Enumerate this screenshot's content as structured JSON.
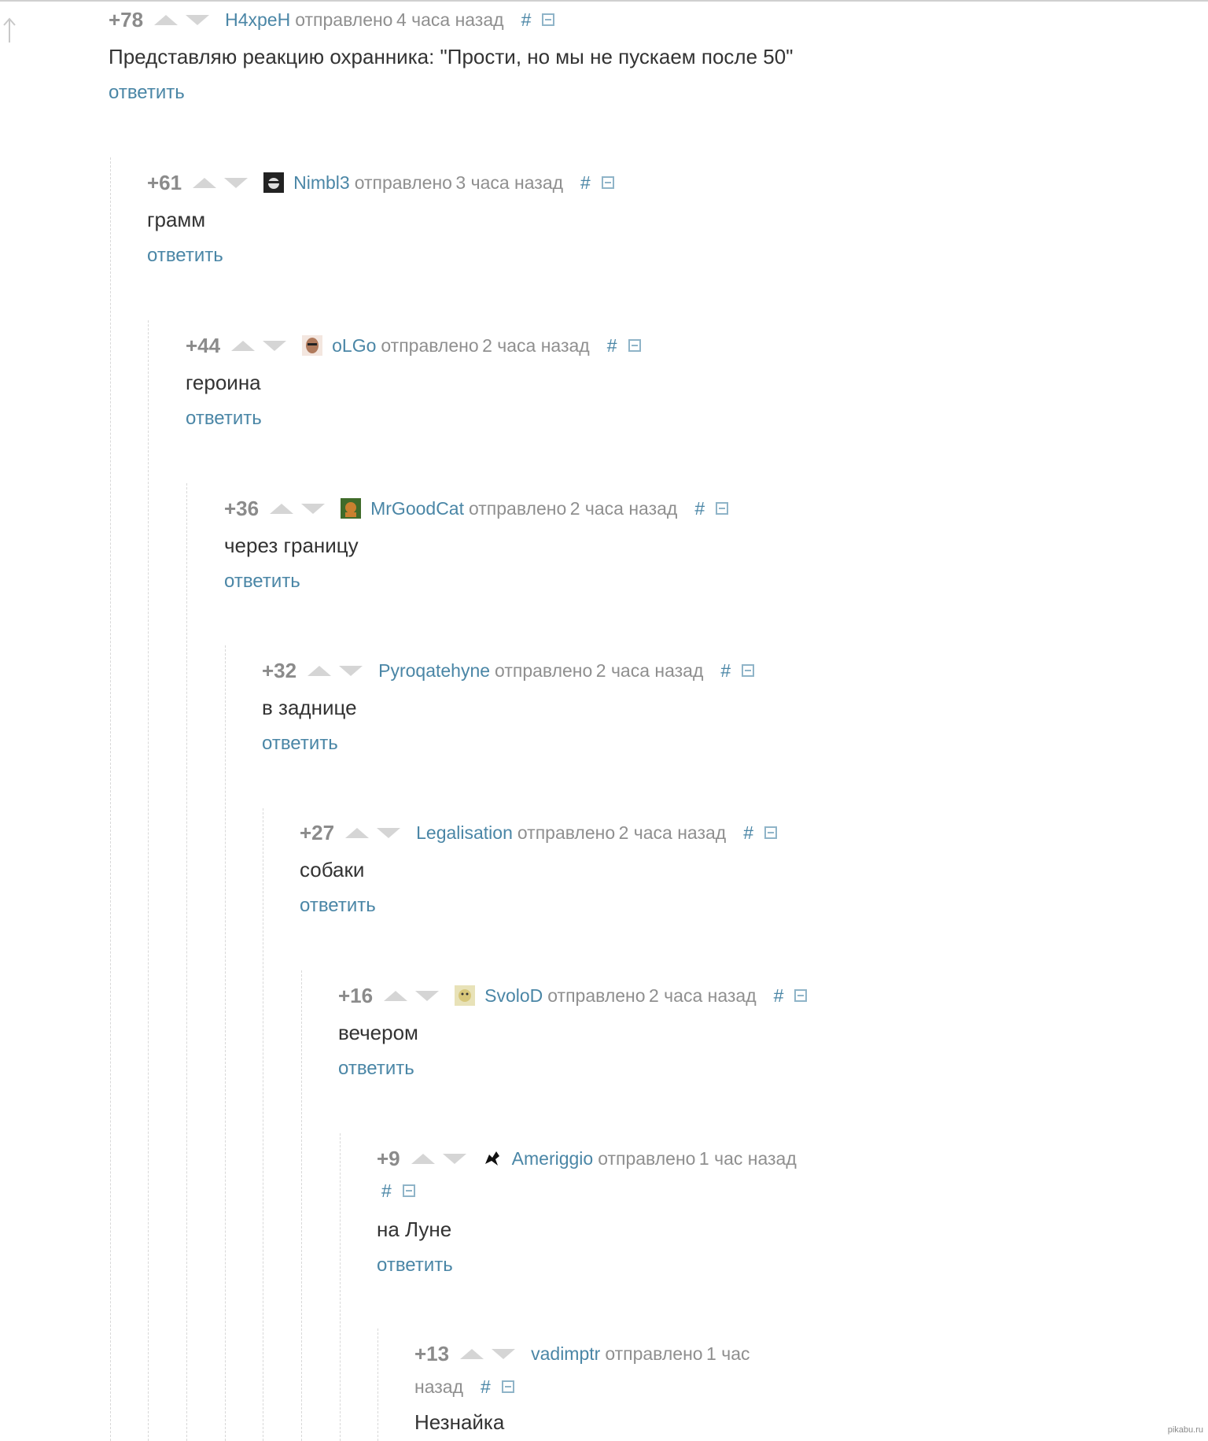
{
  "reply_label": "ответить",
  "sent_word": "отправлено",
  "comments": [
    {
      "rating": "+78",
      "author": "H4xpeH",
      "time": "4 часа назад",
      "hash": "#",
      "text": "Представляю реакцию охранника: \"Прости, но мы не пускаем после 50\""
    },
    {
      "rating": "+61",
      "author": "Nimbl3",
      "time": "3 часа назад",
      "hash": "#",
      "text": "грамм"
    },
    {
      "rating": "+44",
      "author": "oLGo",
      "time": "2 часа назад",
      "hash": "#",
      "text": "героина"
    },
    {
      "rating": "+36",
      "author": "MrGoodCat",
      "time": "2 часа назад",
      "hash": "#",
      "text": "через границу"
    },
    {
      "rating": "+32",
      "author": "Pyroqatehyne",
      "time": "2 часа назад",
      "hash": "#",
      "text": "в заднице"
    },
    {
      "rating": "+27",
      "author": "Legalisation",
      "time": "2 часа назад",
      "hash": "#",
      "text": "собаки"
    },
    {
      "rating": "+16",
      "author": "SvoloD",
      "time": "2 часа назад",
      "hash": "#",
      "text": "вечером"
    },
    {
      "rating": "+9",
      "author": "Ameriggio",
      "time": "1 час назад",
      "hash": "#",
      "text": "на Луне"
    },
    {
      "rating": "+13",
      "author": "vadimptr",
      "time_part1": "1 час",
      "time_part2": "назад",
      "hash": "#",
      "text": "Незнайка"
    }
  ],
  "watermark": "pikabu.ru"
}
